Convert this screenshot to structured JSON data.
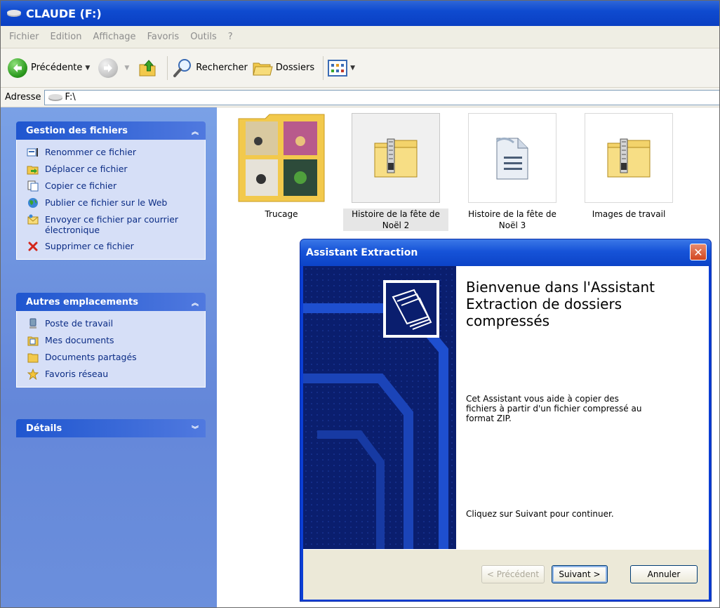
{
  "window": {
    "title": "CLAUDE (F:)"
  },
  "menu": [
    "Fichier",
    "Edition",
    "Affichage",
    "Favoris",
    "Outils",
    "?"
  ],
  "toolbar": {
    "back_label": "Précédente",
    "search_label": "Rechercher",
    "folders_label": "Dossiers"
  },
  "address": {
    "label": "Adresse",
    "value": "F:\\"
  },
  "tasks": {
    "title": "Gestion des fichiers",
    "items": [
      "Renommer ce fichier",
      "Déplacer ce fichier",
      "Copier ce fichier",
      "Publier ce fichier sur le Web",
      "Envoyer ce fichier par courrier électronique",
      "Supprimer ce fichier"
    ]
  },
  "places": {
    "title": "Autres emplacements",
    "items": [
      "Poste de travail",
      "Mes documents",
      "Documents partagés",
      "Favoris réseau"
    ]
  },
  "details": {
    "title": "Détails"
  },
  "files": [
    {
      "name": "Trucage"
    },
    {
      "name": "Histoire de la fête de Noël 2"
    },
    {
      "name": "Histoire de la fête de Noël 3"
    },
    {
      "name": "Images de travail"
    }
  ],
  "dialog": {
    "title": "Assistant Extraction",
    "heading": "Bienvenue dans l'Assistant Extraction de dossiers compressés",
    "description": "Cet Assistant vous aide à copier des fichiers à partir d'un fichier compressé au format ZIP.",
    "continue_text": "Cliquez sur Suivant pour continuer.",
    "buttons": {
      "back": "< Précédent",
      "next": "Suivant >",
      "cancel": "Annuler"
    }
  },
  "colors": {
    "title_bar": "#0f4bd0",
    "sidebar": "#6b8fdc",
    "dialog_accent": "#0a1e6e"
  }
}
